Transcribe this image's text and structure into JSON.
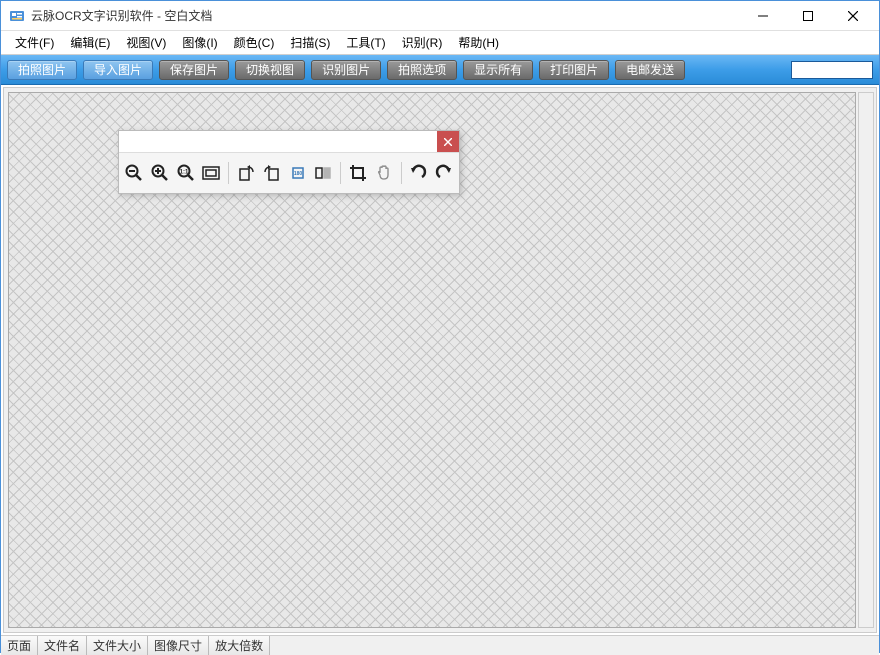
{
  "titlebar": {
    "title": "云脉OCR文字识别软件 - 空白文档"
  },
  "menubar": {
    "items": [
      "文件(F)",
      "编辑(E)",
      "视图(V)",
      "图像(I)",
      "颜色(C)",
      "扫描(S)",
      "工具(T)",
      "识别(R)",
      "帮助(H)"
    ]
  },
  "toolbar": {
    "buttons": [
      {
        "label": "拍照图片",
        "style": "light"
      },
      {
        "label": "导入图片",
        "style": "light"
      },
      {
        "label": "保存图片",
        "style": "grey"
      },
      {
        "label": "切换视图",
        "style": "grey"
      },
      {
        "label": "识别图片",
        "style": "grey"
      },
      {
        "label": "拍照选项",
        "style": "grey"
      },
      {
        "label": "显示所有",
        "style": "grey"
      },
      {
        "label": "打印图片",
        "style": "grey"
      },
      {
        "label": "电邮发送",
        "style": "grey"
      }
    ],
    "input_value": ""
  },
  "floating_toolbox": {
    "header_value": "",
    "icons": [
      "zoom-out-icon",
      "zoom-in-icon",
      "zoom-actual-icon",
      "zoom-fit-icon",
      "rotate-left-icon",
      "rotate-right-icon",
      "rotate-180-icon",
      "flip-icon",
      "crop-icon",
      "pan-icon",
      "undo-icon",
      "redo-icon"
    ]
  },
  "statusbar": {
    "cells": [
      "页面",
      "文件名",
      "文件大小",
      "图像尺寸",
      "放大倍数"
    ]
  }
}
